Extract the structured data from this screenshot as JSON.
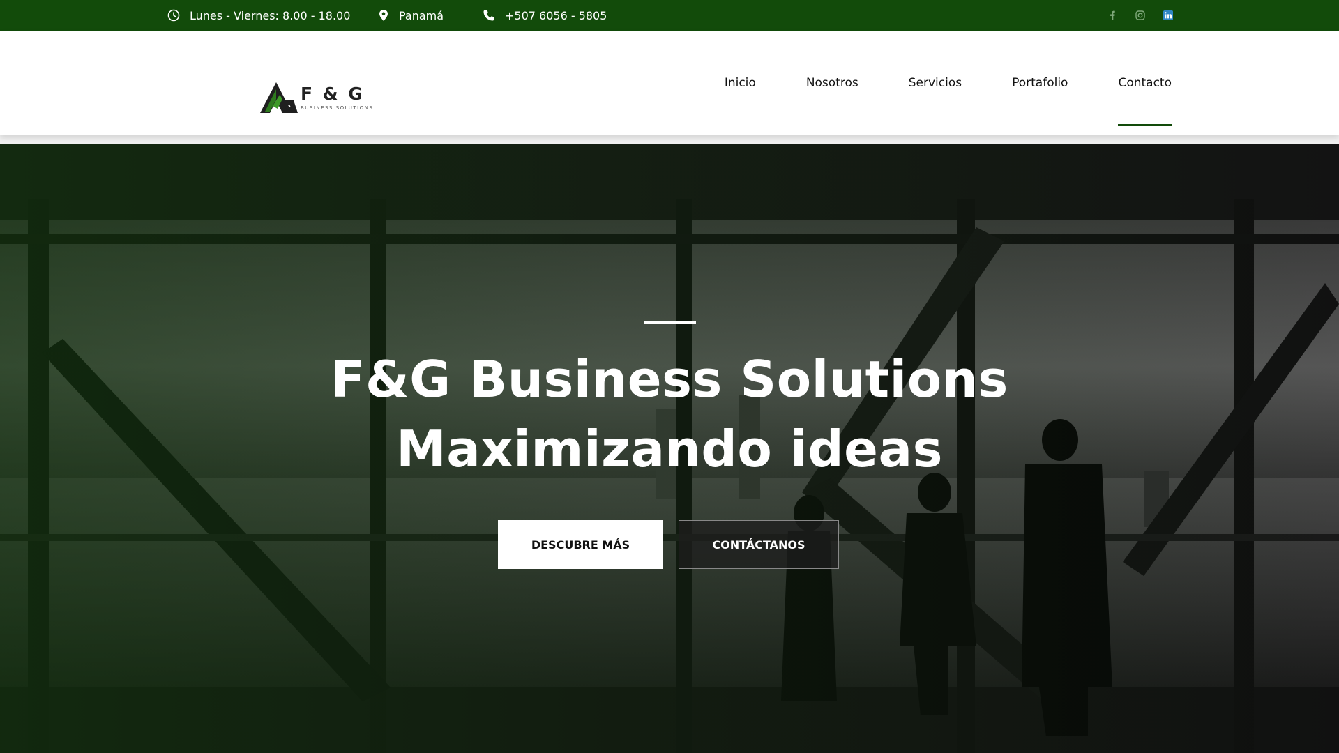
{
  "topbar": {
    "hours": "Lunes - Viernes: 8.00 - 18.00",
    "location": "Panamá",
    "phone": "+507 6056 - 5805",
    "social": [
      "facebook-icon",
      "instagram-icon",
      "linkedin-icon"
    ]
  },
  "header": {
    "logo_name": "F & G",
    "logo_sub": "BUSINESS SOLUTIONS",
    "nav": [
      "Inicio",
      "Nosotros",
      "Servicios",
      "Portafolio",
      "Contacto"
    ],
    "active": "Contacto"
  },
  "hero": {
    "title_line1": "F&G Business Solutions",
    "title_line2": "Maximizando ideas",
    "primary_button": "DESCUBRE MÁS",
    "secondary_button": "CONTÁCTANOS"
  },
  "colors": {
    "brand_green": "#124b0a",
    "white": "#ffffff"
  }
}
